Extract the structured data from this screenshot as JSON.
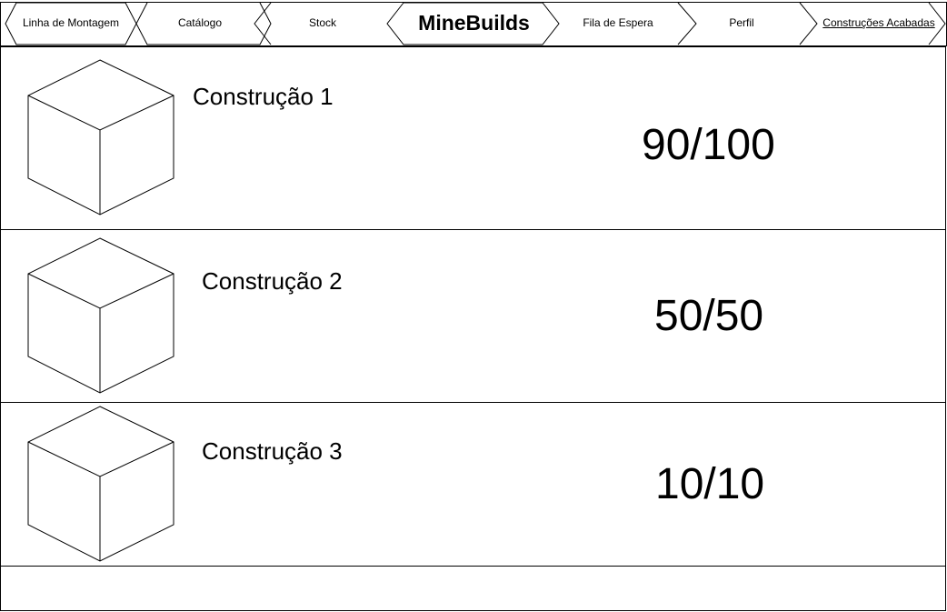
{
  "nav": {
    "items": [
      {
        "label": "Linha de Montagem"
      },
      {
        "label": "Catálogo"
      },
      {
        "label": "Stock"
      },
      {
        "label": "MineBuilds"
      },
      {
        "label": "Fila de Espera"
      },
      {
        "label": "Perfil"
      },
      {
        "label": "Construções Acabadas"
      }
    ],
    "active_index": 6,
    "brand_index": 3
  },
  "builds": [
    {
      "name": "Construção 1",
      "progress": "90/100",
      "icon": "cube-icon"
    },
    {
      "name": "Construção 2",
      "progress": "50/50",
      "icon": "cube-icon"
    },
    {
      "name": "Construção 3",
      "progress": "10/10",
      "icon": "cube-icon"
    }
  ]
}
